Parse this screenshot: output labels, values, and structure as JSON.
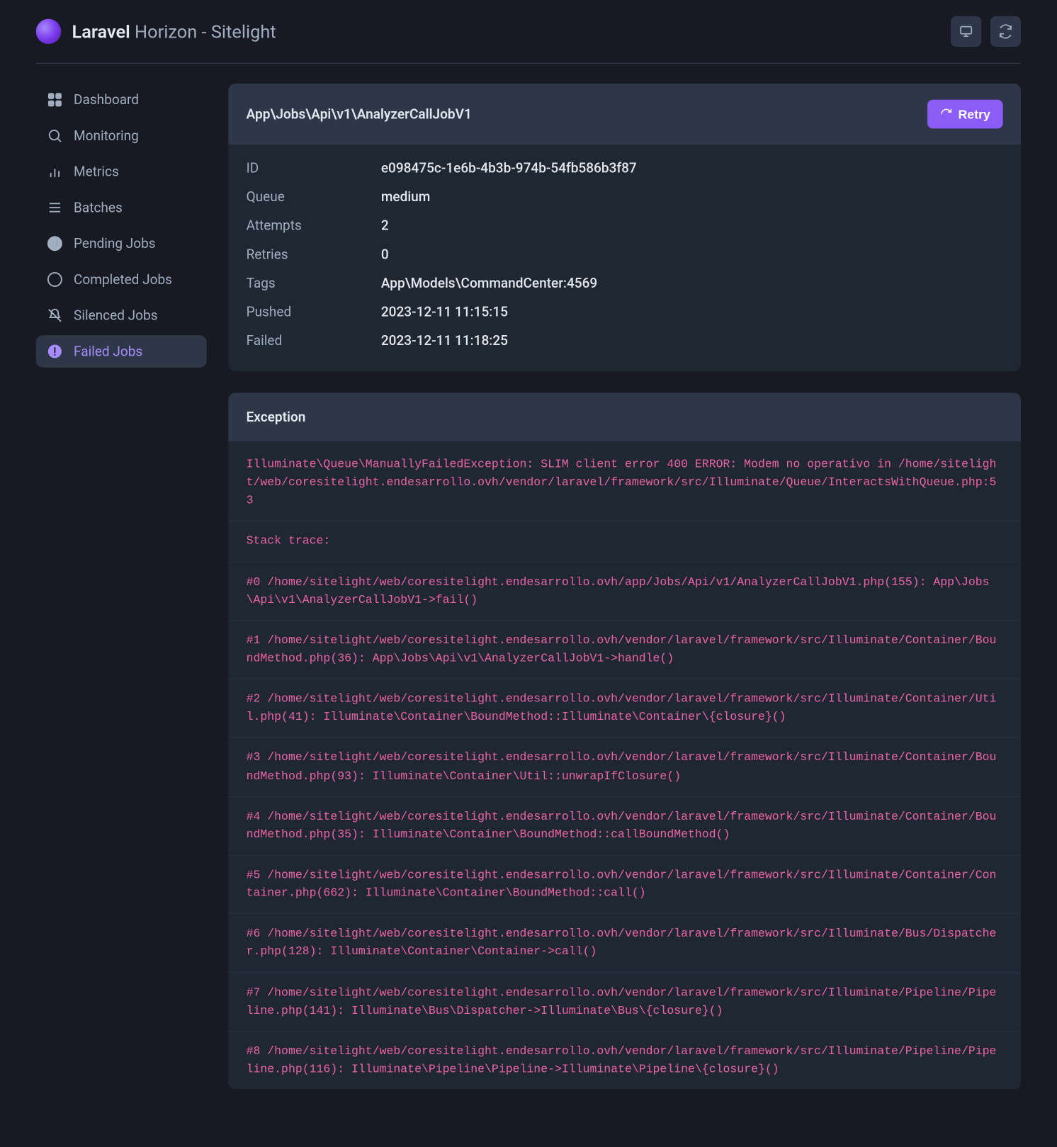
{
  "brand": {
    "bold": "Laravel",
    "rest": " Horizon - Sitelight"
  },
  "sidebar": {
    "items": [
      {
        "label": "Dashboard",
        "icon": "grid"
      },
      {
        "label": "Monitoring",
        "icon": "search"
      },
      {
        "label": "Metrics",
        "icon": "bars"
      },
      {
        "label": "Batches",
        "icon": "list"
      },
      {
        "label": "Pending Jobs",
        "icon": "pause"
      },
      {
        "label": "Completed Jobs",
        "icon": "check"
      },
      {
        "label": "Silenced Jobs",
        "icon": "mute"
      },
      {
        "label": "Failed Jobs",
        "icon": "alert",
        "active": true
      }
    ]
  },
  "job": {
    "name": "App\\Jobs\\Api\\v1\\AnalyzerCallJobV1",
    "retry_label": "Retry",
    "rows": [
      {
        "label": "ID",
        "value": "e098475c-1e6b-4b3b-974b-54fb586b3f87"
      },
      {
        "label": "Queue",
        "value": "medium"
      },
      {
        "label": "Attempts",
        "value": "2"
      },
      {
        "label": "Retries",
        "value": "0"
      },
      {
        "label": "Tags",
        "value": "App\\Models\\CommandCenter:4569"
      },
      {
        "label": "Pushed",
        "value": "2023-12-11 11:15:15"
      },
      {
        "label": "Failed",
        "value": "2023-12-11 11:18:25"
      }
    ]
  },
  "exception": {
    "title": "Exception",
    "lines": [
      "Illuminate\\Queue\\ManuallyFailedException: SLIM client error 400 ERROR: Modem no operativo in /home/sitelight/web/coresitelight.endesarrollo.ovh/vendor/laravel/framework/src/Illuminate/Queue/InteractsWithQueue.php:53",
      "Stack trace:",
      "#0 /home/sitelight/web/coresitelight.endesarrollo.ovh/app/Jobs/Api/v1/AnalyzerCallJobV1.php(155): App\\Jobs\\Api\\v1\\AnalyzerCallJobV1->fail()",
      "#1 /home/sitelight/web/coresitelight.endesarrollo.ovh/vendor/laravel/framework/src/Illuminate/Container/BoundMethod.php(36): App\\Jobs\\Api\\v1\\AnalyzerCallJobV1->handle()",
      "#2 /home/sitelight/web/coresitelight.endesarrollo.ovh/vendor/laravel/framework/src/Illuminate/Container/Util.php(41): Illuminate\\Container\\BoundMethod::Illuminate\\Container\\{closure}()",
      "#3 /home/sitelight/web/coresitelight.endesarrollo.ovh/vendor/laravel/framework/src/Illuminate/Container/BoundMethod.php(93): Illuminate\\Container\\Util::unwrapIfClosure()",
      "#4 /home/sitelight/web/coresitelight.endesarrollo.ovh/vendor/laravel/framework/src/Illuminate/Container/BoundMethod.php(35): Illuminate\\Container\\BoundMethod::callBoundMethod()",
      "#5 /home/sitelight/web/coresitelight.endesarrollo.ovh/vendor/laravel/framework/src/Illuminate/Container/Container.php(662): Illuminate\\Container\\BoundMethod::call()",
      "#6 /home/sitelight/web/coresitelight.endesarrollo.ovh/vendor/laravel/framework/src/Illuminate/Bus/Dispatcher.php(128): Illuminate\\Container\\Container->call()",
      "#7 /home/sitelight/web/coresitelight.endesarrollo.ovh/vendor/laravel/framework/src/Illuminate/Pipeline/Pipeline.php(141): Illuminate\\Bus\\Dispatcher->Illuminate\\Bus\\{closure}()",
      "#8 /home/sitelight/web/coresitelight.endesarrollo.ovh/vendor/laravel/framework/src/Illuminate/Pipeline/Pipeline.php(116): Illuminate\\Pipeline\\Pipeline->Illuminate\\Pipeline\\{closure}()"
    ]
  }
}
